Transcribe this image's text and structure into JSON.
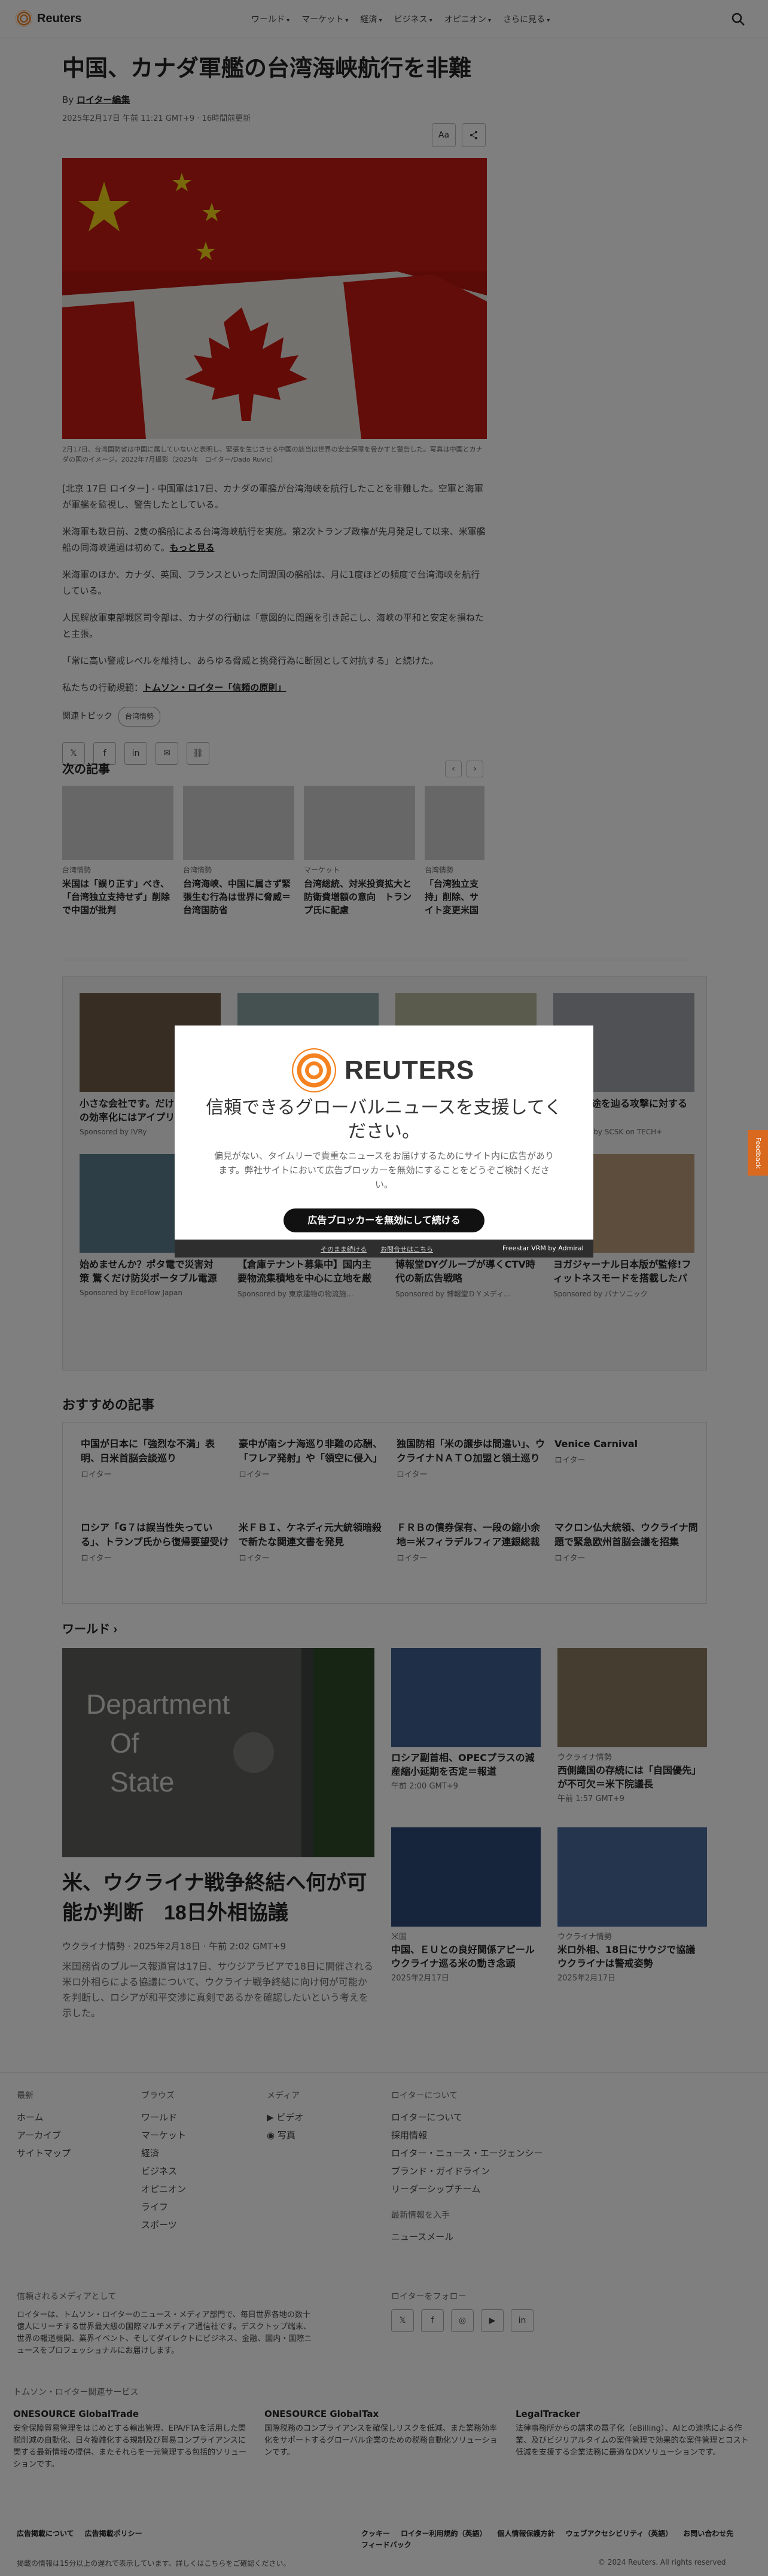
{
  "header": {
    "logo": "Reuters",
    "nav": [
      "ワールド",
      "マーケット",
      "経済",
      "ビジネス",
      "オピニオン",
      "さらに見る"
    ]
  },
  "article": {
    "title": "中国、カナダ軍艦の台湾海峡航行を非難",
    "by_prefix": "By ",
    "author": "ロイター編集",
    "datetime": "2025年2月17日 午前 11:21 GMT+9 · 16時間前更新",
    "text_size": "Aa",
    "caption": "2月17日、台湾国防省は中国に属していないと表明し、緊張を生じさせる中国の該当は世界の安全保障を脅かすと警告した。写真は中国とカナダの国のイメージ。2022年7月撮影（2025年　ロイター/Dado Ruvic）",
    "p1": "[北京 17日 ロイター] - 中国軍は17日、カナダの軍艦が台湾海峡を航行したことを非難した。空軍と海軍が軍艦を監視し、警告したとしている。",
    "p2a": "米海軍も数日前、2隻の艦船による台湾海峡航行を実施。第2次トランプ政権が先月発足して以来、米軍艦船の同海峡通過は初めて。",
    "p2_link": "もっと見る",
    "p3": "米海軍のほか、カナダ、英国、フランスといった同盟国の艦船は、月に1度ほどの頻度で台湾海峡を航行している。",
    "p4": "人民解放軍東部戦区司令部は、カナダの行動は「意図的に問題を引き起こし、海峡の平和と安定を損ねたと主張。",
    "p5": "「常に高い警戒レベルを維持し、あらゆる脅威と挑発行為に断固として対抗する」と続けた。",
    "p6_prefix": "私たちの行動規範：",
    "p6_link": "トムソン・ロイター「信頼の原則」",
    "topics_label": "関連トピック",
    "topic": "台湾情勢"
  },
  "next": {
    "heading": "次の記事",
    "cards": [
      {
        "kicker": "台湾情勢",
        "title": "米国は「誤り正す」べき、「台湾独立支持せず」削除で中国が批判"
      },
      {
        "kicker": "台湾情勢",
        "title": "台湾海峡、中国に属さず緊張生む行為は世界に脅威＝台湾国防省"
      },
      {
        "kicker": "マーケット",
        "title": "台湾総統、対米投資拡大と防衛費増額の意向　トランプ氏に配慮"
      },
      {
        "kicker": "台湾情勢",
        "title": "「台湾独立支持」削除、サイト変更米国務省説明"
      }
    ]
  },
  "ads": [
    {
      "title": "小さな会社です。だけど、業務の効率化にはアイプリーに任せ…",
      "sponsor": "Sponsored by IVRy"
    },
    {
      "title": "",
      "sponsor": ""
    },
    {
      "title": "",
      "sponsor": ""
    },
    {
      "title": "炒化の一途を辿る攻撃に対する対策",
      "sponsor": "Sponsored by SCSK on TECH+"
    },
    {
      "title": "始めませんか？ポタ電で災害対策 驚くだけ防災ポータブル電源",
      "sponsor": "Sponsored by EcoFlow Japan"
    },
    {
      "title": "【倉庫テナント募集中】国内主要物流集積地を中心に立地を厳選し、物流施設の開発…",
      "sponsor": "Sponsored by 東京建物の物流施…"
    },
    {
      "title": "博報堂DYグループが導くCTV時代の新広告戦略",
      "sponsor": "Sponsored by 博報堂ＤＹメディ…"
    },
    {
      "title": "ヨガジャーナル日本版が監修!フィットネスモードを搭載したパナソニックのLE…",
      "sponsor": "Sponsored by パナソニック"
    }
  ],
  "modal": {
    "brand": "REUTERS",
    "heading": "信頼できるグローバルニュースを支援してください。",
    "text": "偏見がない、タイムリーで貴重なニュースをお届けするためにサイト内に広告があります。弊社サイトにおいて広告ブロッカーを無効にすることをどうぞご検討ください。",
    "button": "広告ブロッカーを無効にして続ける",
    "link1": "そのまま続ける",
    "link2": "お問合せはこちら",
    "powered": "Freestar VRM  by Admiral"
  },
  "feedback": "Feedback",
  "recommended": {
    "heading": "おすすめの記事",
    "items": [
      {
        "title": "中国が日本に「強烈な不満」表明、日米首脳会談巡り",
        "src": "ロイター"
      },
      {
        "title": "豪中が南シナ海巡り非難の応酬、「フレア発射」や「領空に侵入」",
        "src": "ロイター"
      },
      {
        "title": "独国防相「米の譲歩は間違い」、ウクライナＮＡＴＯ加盟と領土巡り",
        "src": "ロイター"
      },
      {
        "title": "Venice Carnival",
        "src": "ロイター"
      },
      {
        "title": "ロシア「G７は誤当性失っている」、トランプ氏から復帰要望受け",
        "src": "ロイター"
      },
      {
        "title": "米ＦＢＩ、ケネディ元大統領暗殺で新たな関連文書を発見",
        "src": "ロイター"
      },
      {
        "title": "ＦＲＢの債券保有、一段の縮小余地＝米フィラデルフィア連銀総裁",
        "src": "ロイター"
      },
      {
        "title": "マクロン仏大統領、ウクライナ問題で緊急欧州首脳会議を招集",
        "src": "ロイター"
      }
    ]
  },
  "world": {
    "heading": "ワールド ›",
    "main_title": "米、ウクライナ戦争終結へ何が可能か判断　18日外相協議",
    "main_meta": "ウクライナ情勢 · 2025年2月18日 · 午前 2:02 GMT+9",
    "main_desc": "米国務省のブルース報道官は17日、サウジアラビアで18日に開催される米ロ外相らによる協議について、ウクライナ戦争終結に向け何が可能かを判断し、ロシアが和平交渉に真剣であるかを確認したいという考えを示した。",
    "items": [
      {
        "kicker": "",
        "title": "ロシア副首相、OPECプラスの減産縮小延期を否定＝報道",
        "time": "午前 2:00 GMT+9"
      },
      {
        "kicker": "ウクライナ情勢",
        "title": "西側識国の存続には「自国優先」が不可欠＝米下院議長",
        "time": "午前 1:57 GMT+9"
      },
      {
        "kicker": "米国",
        "title": "中国、ＥＵとの良好関係アピール ウクライナ巡る米の動き念頭",
        "time": "2025年2月17日"
      },
      {
        "kicker": "ウクライナ情勢",
        "title": "米ロ外相、18日にサウジで協議 ウクライナは警戒姿勢",
        "time": "2025年2月17日"
      }
    ]
  },
  "footer": {
    "latest_h": "最新",
    "latest": [
      "ホーム",
      "アーカイブ",
      "サイトマップ"
    ],
    "browse_h": "ブラウズ",
    "browse": [
      "ワールド",
      "マーケット",
      "経済",
      "ビジネス",
      "オピニオン",
      "ライフ",
      "スポーツ"
    ],
    "media_h": "メディア",
    "media": [
      "ビデオ",
      "写真"
    ],
    "about_h": "ロイターについて",
    "about": [
      "ロイターについて",
      "採用情報",
      "ロイター・ニュース・エージェンシー",
      "ブランド・ガイドライン",
      "リーダーシップチーム"
    ],
    "news_h": "最新情報を入手",
    "news": "ニュースメール",
    "trust_h": "信頼されるメディアとして",
    "trust": "ロイターは、トムソン・ロイターのニュース・メディア部門で、毎日世界各地の数十億人にリーチする世界最大級の国際マルチメディア通信社です。デスクトップ端末、世界の報道機関、業界イベント、そしてダイレクトにビジネス、金融、国内・国際ニュースをプロフェッショナルにお届けします。",
    "follow_h": "ロイターをフォロー",
    "tr_h": "トムソン・ロイター関連サービス",
    "svc": [
      {
        "name": "ONESOURCE GlobalTrade",
        "desc": "安全保障貿易管理をはじめとする輸出管理、EPA/FTAを活用した関税削減の自動化、日々複雑化する規制及び貿易コンプライアンスに関する最新情報の提供、またそれらを一元管理する包括的ソリューションです。"
      },
      {
        "name": "ONESOURCE GlobalTax",
        "desc": "国際税務のコンプライアンスを確保しリスクを低減、また業務効率化をサポートするグローバル企業のための税務自動化ソリューションです。"
      },
      {
        "name": "LegalTracker",
        "desc": "法律事務所からの請求の電子化（eBilling）、AIとの連携による作業、及びビジリアルタイムの案件管理で効果的な案件管理とコスト低減を支援する企業法務に最適なDXソリューションです。"
      }
    ],
    "bottom": [
      "広告掲載について",
      "広告掲載ポリシー",
      "クッキー",
      "ロイター利用規約（英語）",
      "個人情報保護方針",
      "ウェブアクセシビリティ（英語）",
      "お問い合わせ先",
      "フィードバック"
    ],
    "note": "掲載の情報は15分以上の遅れで表示しています。詳しくはこちらをご確認ください。",
    "copyright": "© 2024 Reuters. All rights reserved"
  }
}
